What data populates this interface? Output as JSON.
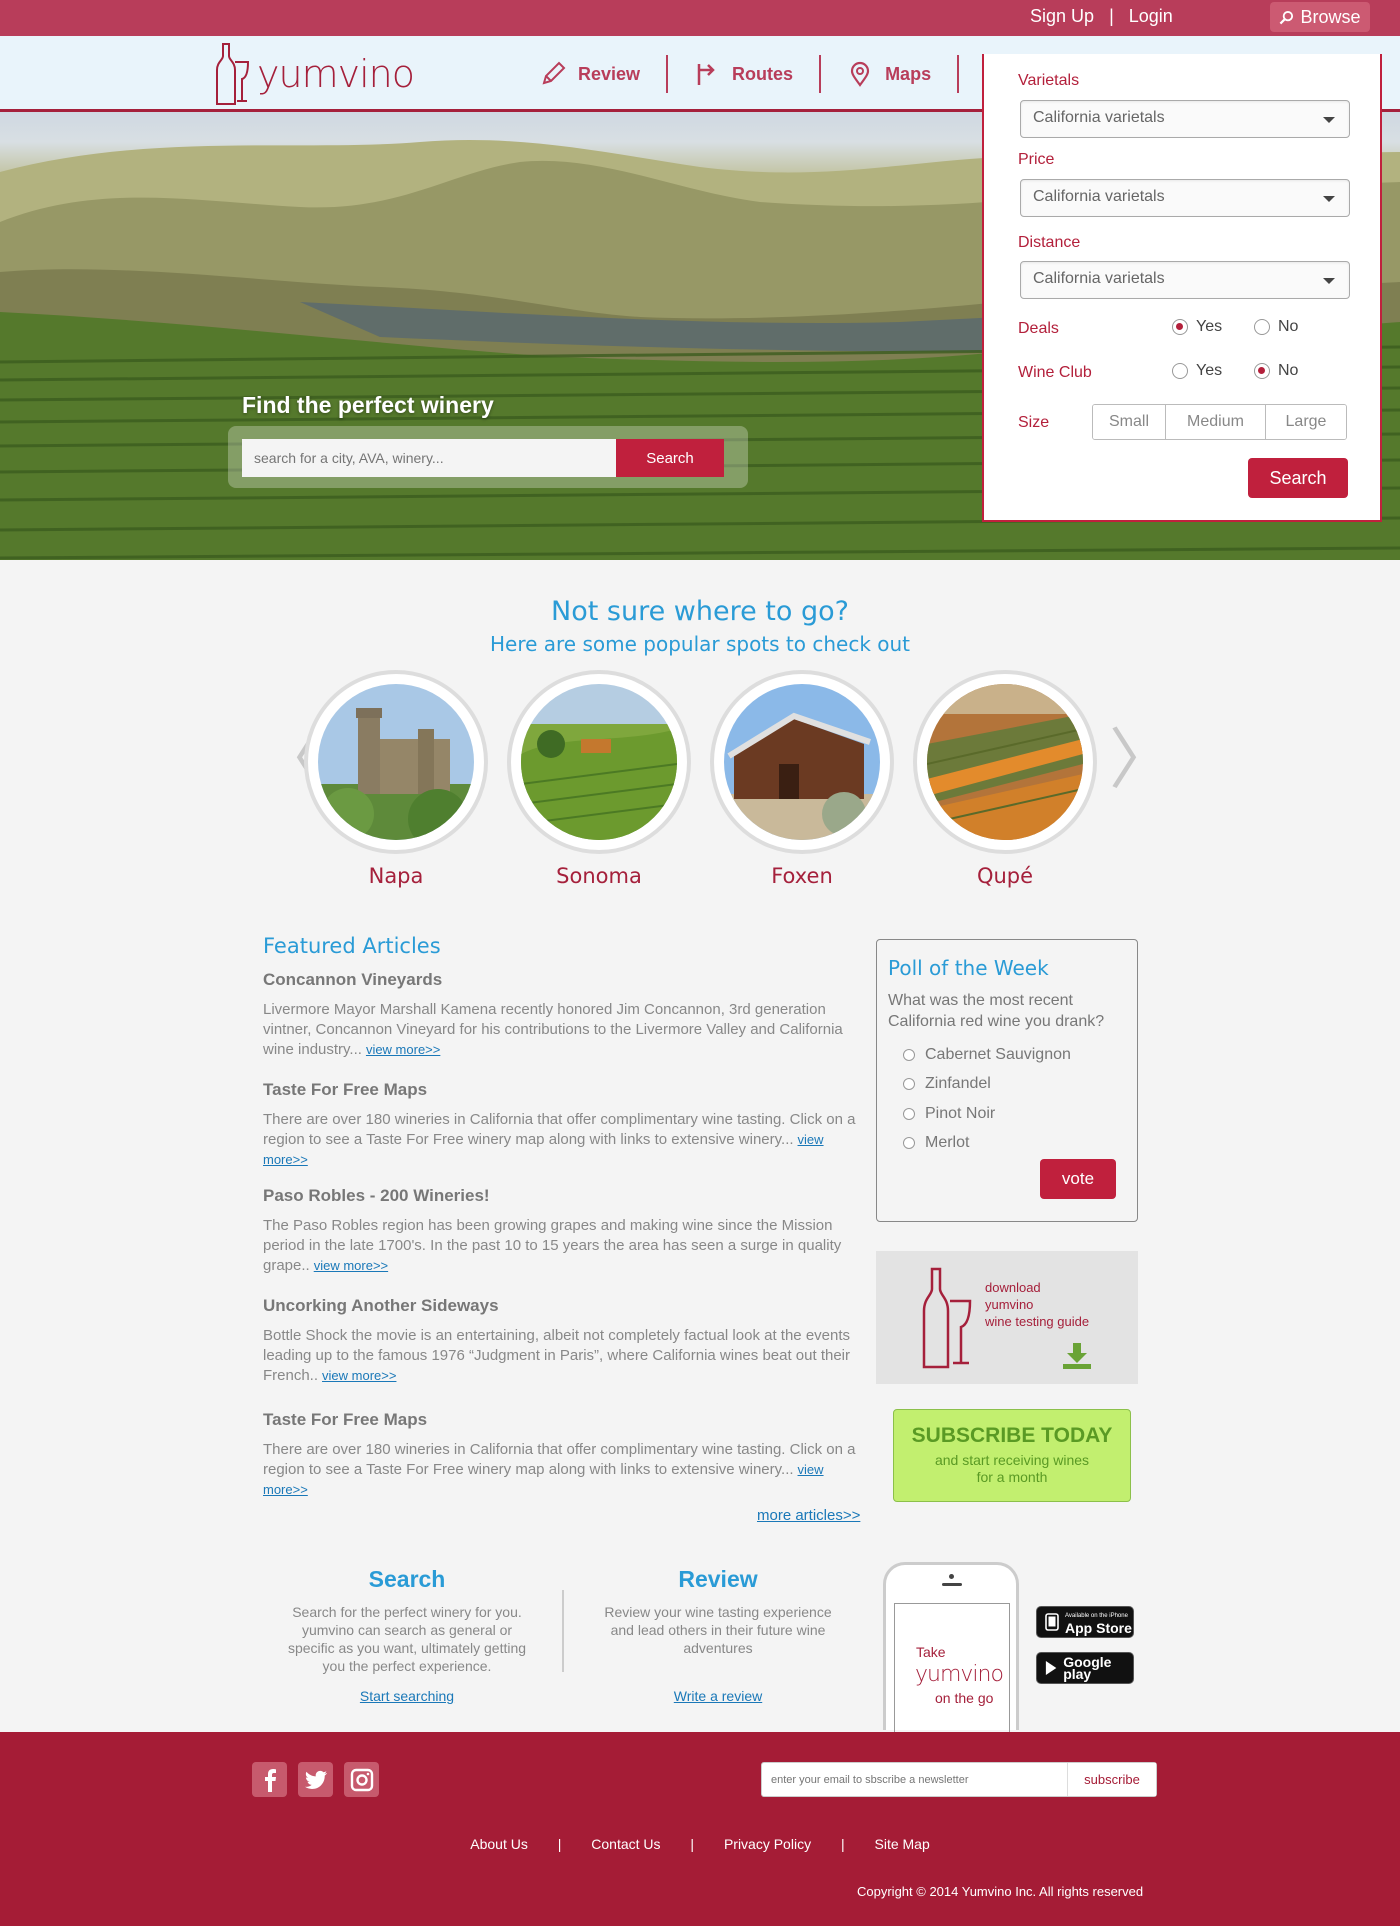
{
  "topbar": {
    "signup": "Sign Up",
    "separator": "|",
    "login": "Login",
    "browse": "Browse"
  },
  "header": {
    "brand": "yumvino"
  },
  "nav": [
    {
      "label": "Review",
      "icon": "pencil-icon"
    },
    {
      "label": "Routes",
      "icon": "route-icon"
    },
    {
      "label": "Maps",
      "icon": "map-pin-icon"
    },
    {
      "label": "",
      "icon": "tag-icon"
    }
  ],
  "hero": {
    "title": "Find the perfect winery",
    "search_placeholder": "search for a city, AVA, winery...",
    "search_button": "Search"
  },
  "browse_panel": {
    "varietals_label": "Varietals",
    "varietals_value": "California varietals",
    "price_label": "Price",
    "price_value": "California varietals",
    "distance_label": "Distance",
    "distance_value": "California varietals",
    "deals_label": "Deals",
    "deals_yes": "Yes",
    "deals_no": "No",
    "deals_selected": "Yes",
    "wineclub_label": "Wine Club",
    "wineclub_yes": "Yes",
    "wineclub_no": "No",
    "wineclub_selected": "No",
    "size_label": "Size",
    "size_small": "Small",
    "size_medium": "Medium",
    "size_large": "Large",
    "search_button": "Search"
  },
  "spots": {
    "title": "Not sure where to go?",
    "subtitle": "Here are some popular spots to check out",
    "prev": "〈",
    "next": "〉",
    "items": [
      {
        "name": "Napa"
      },
      {
        "name": "Sonoma"
      },
      {
        "name": "Foxen"
      },
      {
        "name": "Qupé"
      }
    ]
  },
  "articles": {
    "heading": "Featured Articles",
    "items": [
      {
        "title": "Concannon Vineyards",
        "body": "Livermore Mayor Marshall Kamena recently honored Jim Concannon, 3rd generation vintner, Concannon Vineyard for his contributions to the Livermore Valley and California wine industry...",
        "link": "view more>>"
      },
      {
        "title": "Taste For Free Maps",
        "body": "There are over 180 wineries in California that offer complimentary wine tasting. Click on a region to see a Taste For Free winery map along with links to extensive winery...",
        "link": "view more>>"
      },
      {
        "title": "Paso Robles - 200 Wineries!",
        "body": "The Paso Robles region has been growing grapes and making wine since the Mission period in the late 1700's. In the past 10 to 15 years the area has seen a surge in quality grape..",
        "link": "view more>>"
      },
      {
        "title": "Uncorking Another Sideways",
        "body": "Bottle Shock the movie is an entertaining, albeit not completely factual look at the events leading up to the famous 1976 “Judgment in Paris”, where California wines beat out their French..",
        "link": "view more>>"
      },
      {
        "title": "Taste For Free Maps",
        "body": "There are over 180 wineries in California that offer complimentary wine tasting. Click on a region to see a Taste For Free winery map along with links to extensive winery...",
        "link": "view more>>"
      }
    ],
    "more": "more articles>>"
  },
  "poll": {
    "title": "Poll of the Week",
    "question": "What was the most recent California red wine you drank?",
    "options": [
      "Cabernet Sauvignon",
      "Zinfandel",
      "Pinot Noir",
      "Merlot"
    ],
    "vote": "vote"
  },
  "guide": {
    "line1": "download",
    "line2": "yumvino",
    "line3": "wine testing guide"
  },
  "subscribe": {
    "title": "SUBSCRIBE TODAY",
    "line1": "and start receiving wines",
    "line2": "for a month"
  },
  "features": {
    "search_title": "Search",
    "search_body": "Search for the perfect winery for you.  yumvino can search as general or specific as you want, ultimately getting you the perfect experience.",
    "search_link": "Start searching",
    "review_title": "Review",
    "review_body": "Review your wine tasting experience and lead others in their future wine adventures",
    "review_link": "Write a review"
  },
  "phone": {
    "take": "Take",
    "brand": "yumvino",
    "on_the_go": "on the go"
  },
  "stores": {
    "apple_small": "Available on the iPhone",
    "apple": "App Store",
    "google": "Google play"
  },
  "footer": {
    "newsletter_placeholder": "enter your email to sbscribe a newsletter",
    "newsletter_button": "subscribe",
    "links": [
      "About Us",
      "Contact Us",
      "Privacy Policy",
      "Site Map"
    ],
    "separator": "|",
    "copyright": "Copyright © 2014 Yumvino Inc. All rights reserved"
  },
  "colors": {
    "brand": "#a5203b",
    "accent_blue": "#2a9bd6",
    "subscribe_green": "#c2ef6f"
  }
}
